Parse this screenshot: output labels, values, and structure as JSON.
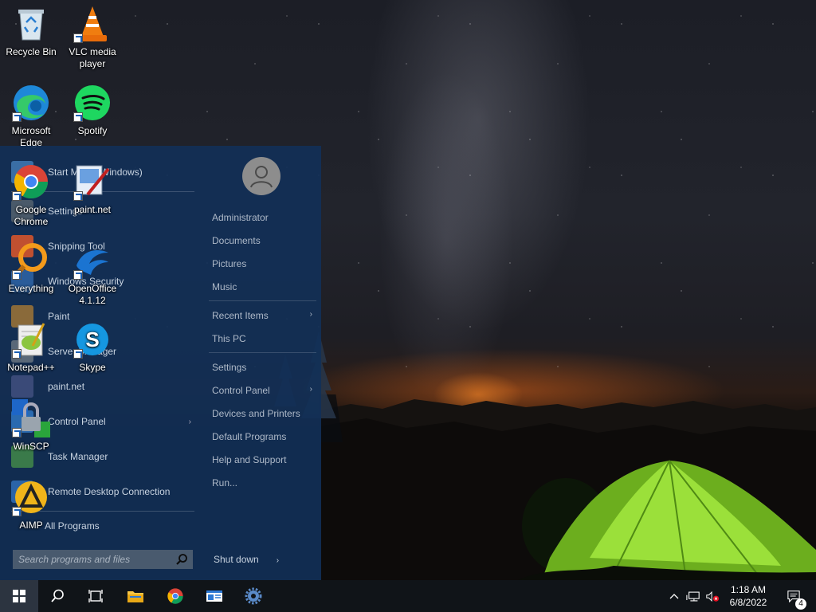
{
  "desktop": {
    "icons": [
      {
        "label": "Recycle Bin"
      },
      {
        "label": "VLC media player"
      },
      {
        "label": "Microsoft Edge"
      },
      {
        "label": "Spotify"
      },
      {
        "label": "Google Chrome"
      },
      {
        "label": "paint.net"
      },
      {
        "label": "Everything"
      },
      {
        "label": "OpenOffice 4.1.12"
      },
      {
        "label": "Notepad++"
      },
      {
        "label": "Skype"
      },
      {
        "label": "WinSCP"
      },
      {
        "label": "AIMP"
      }
    ]
  },
  "start_menu": {
    "programs": [
      {
        "label": "Start Menu (Windows)",
        "icon": "start-menu-icon"
      },
      {
        "label": "Settings",
        "icon": "settings-icon"
      },
      {
        "label": "Snipping Tool",
        "icon": "scissors-icon"
      },
      {
        "label": "Windows Security",
        "icon": "shield-icon"
      },
      {
        "label": "Paint",
        "icon": "palette-icon"
      },
      {
        "label": "Server Manager",
        "icon": "server-icon"
      },
      {
        "label": "paint.net",
        "icon": "paintnet-icon"
      },
      {
        "label": "Control Panel",
        "icon": "control-panel-icon",
        "submenu_arrow": "›"
      },
      {
        "label": "Task Manager",
        "icon": "task-manager-icon"
      },
      {
        "label": "Remote Desktop Connection",
        "icon": "remote-desktop-icon"
      }
    ],
    "all_programs": "All Programs",
    "search_placeholder": "Search programs and files",
    "right": [
      {
        "label": "Administrator"
      },
      {
        "label": "Documents"
      },
      {
        "label": "Pictures"
      },
      {
        "label": "Music"
      },
      {
        "label": "Recent Items",
        "submenu_arrow": "›"
      },
      {
        "label": "This PC"
      },
      {
        "label": "Settings"
      },
      {
        "label": "Control Panel",
        "submenu_arrow": "›"
      },
      {
        "label": "Devices and Printers"
      },
      {
        "label": "Default Programs"
      },
      {
        "label": "Help and Support"
      },
      {
        "label": "Run..."
      }
    ],
    "shutdown": "Shut down",
    "shutdown_arrow": "›"
  },
  "taskbar": {
    "clock_time": "1:18 AM",
    "clock_date": "6/8/2022",
    "notification_count": "4"
  },
  "colors": {
    "start_menu_bg": "#123058",
    "taskbar_bg": "#101418",
    "tent_green": "#8fd629"
  }
}
